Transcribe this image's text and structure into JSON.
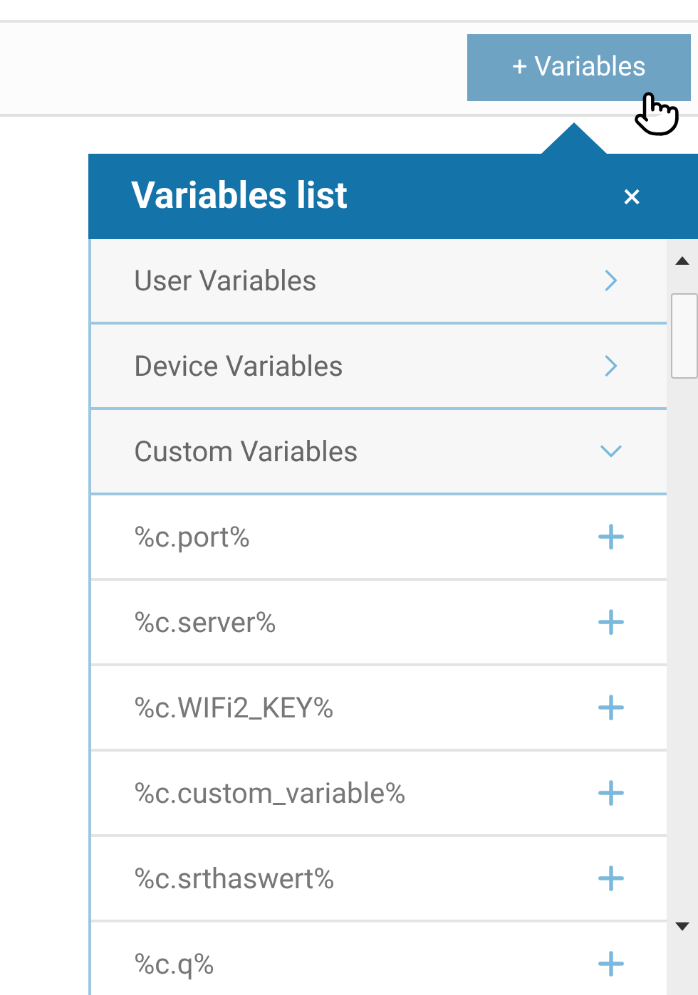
{
  "toolbar": {
    "add_button": "+ Variables"
  },
  "popup": {
    "title": "Variables list",
    "close": "×",
    "groups": [
      {
        "label": "User Variables",
        "expanded": false
      },
      {
        "label": "Device Variables",
        "expanded": false
      },
      {
        "label": "Custom Variables",
        "expanded": true,
        "items": [
          {
            "label": "%c.port%"
          },
          {
            "label": "%c.server%"
          },
          {
            "label": "%c.WIFi2_KEY%"
          },
          {
            "label": "%c.custom_variable%"
          },
          {
            "label": "%c.srthaswert%"
          },
          {
            "label": "%c.q%"
          }
        ]
      }
    ]
  }
}
